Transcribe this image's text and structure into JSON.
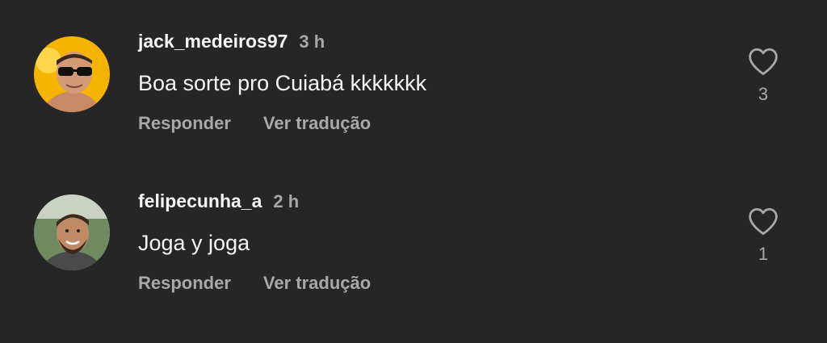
{
  "comments": [
    {
      "username": "jack_medeiros97",
      "time": "3 h",
      "text": "Boa sorte pro Cuiabá kkkkkkk",
      "reply_label": "Responder",
      "translate_label": "Ver tradução",
      "likes": "3",
      "avatar_colors": {
        "background": "#f4b400",
        "skin": "#c98a6a",
        "shades": "#111111"
      }
    },
    {
      "username": "felipecunha_a",
      "time": "2 h",
      "text": "Joga y joga",
      "reply_label": "Responder",
      "translate_label": "Ver tradução",
      "likes": "1",
      "avatar_colors": {
        "background": "#6f8a5e",
        "skin": "#c08a66",
        "hair": "#3a2a1e"
      }
    }
  ],
  "colors": {
    "background": "#262626",
    "primary_text": "#f5f5f5",
    "secondary_text": "#a8a8a8"
  }
}
